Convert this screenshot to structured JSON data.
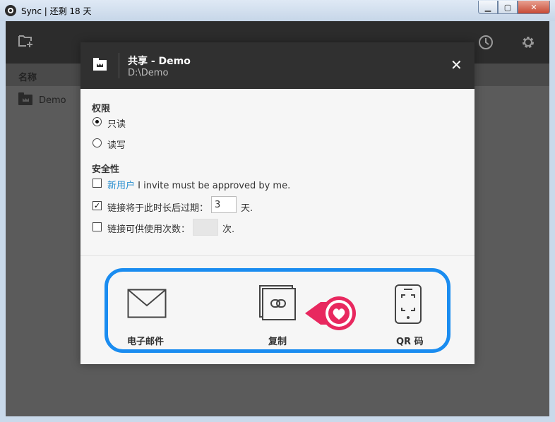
{
  "window": {
    "title": "Sync | 还剩 18 天",
    "buttons": {
      "minimize": "▁",
      "maximize": "▢",
      "close": "✕"
    }
  },
  "toolbar": {
    "icons": [
      "add-folder-icon",
      "history-icon",
      "settings-icon"
    ]
  },
  "list": {
    "column_name": "名称",
    "items": [
      {
        "name": "Demo"
      }
    ]
  },
  "dialog": {
    "title": "共享 - Demo",
    "path": "D:\\Demo",
    "close": "✕",
    "permissions": {
      "heading": "权限",
      "options": [
        {
          "label": "只读",
          "selected": true
        },
        {
          "label": "读写",
          "selected": false
        }
      ]
    },
    "security": {
      "heading": "安全性",
      "approve_link": "新用户",
      "approve_text": " I invite must be approved by me.",
      "approve_checked": false,
      "expire_label": "链接将于此时长后过期：",
      "expire_value": "3",
      "expire_unit": "天.",
      "expire_checked": true,
      "uses_label": "链接可供使用次数：",
      "uses_value": "",
      "uses_unit": "次.",
      "uses_checked": false
    },
    "share_actions": [
      {
        "label": "电子邮件",
        "icon": "envelope-icon"
      },
      {
        "label": "复制",
        "icon": "copy-link-icon"
      },
      {
        "label": "QR 码",
        "icon": "qr-phone-icon"
      }
    ],
    "accent_color": "#1a8cf0",
    "pointer_color": "#e8285f"
  }
}
